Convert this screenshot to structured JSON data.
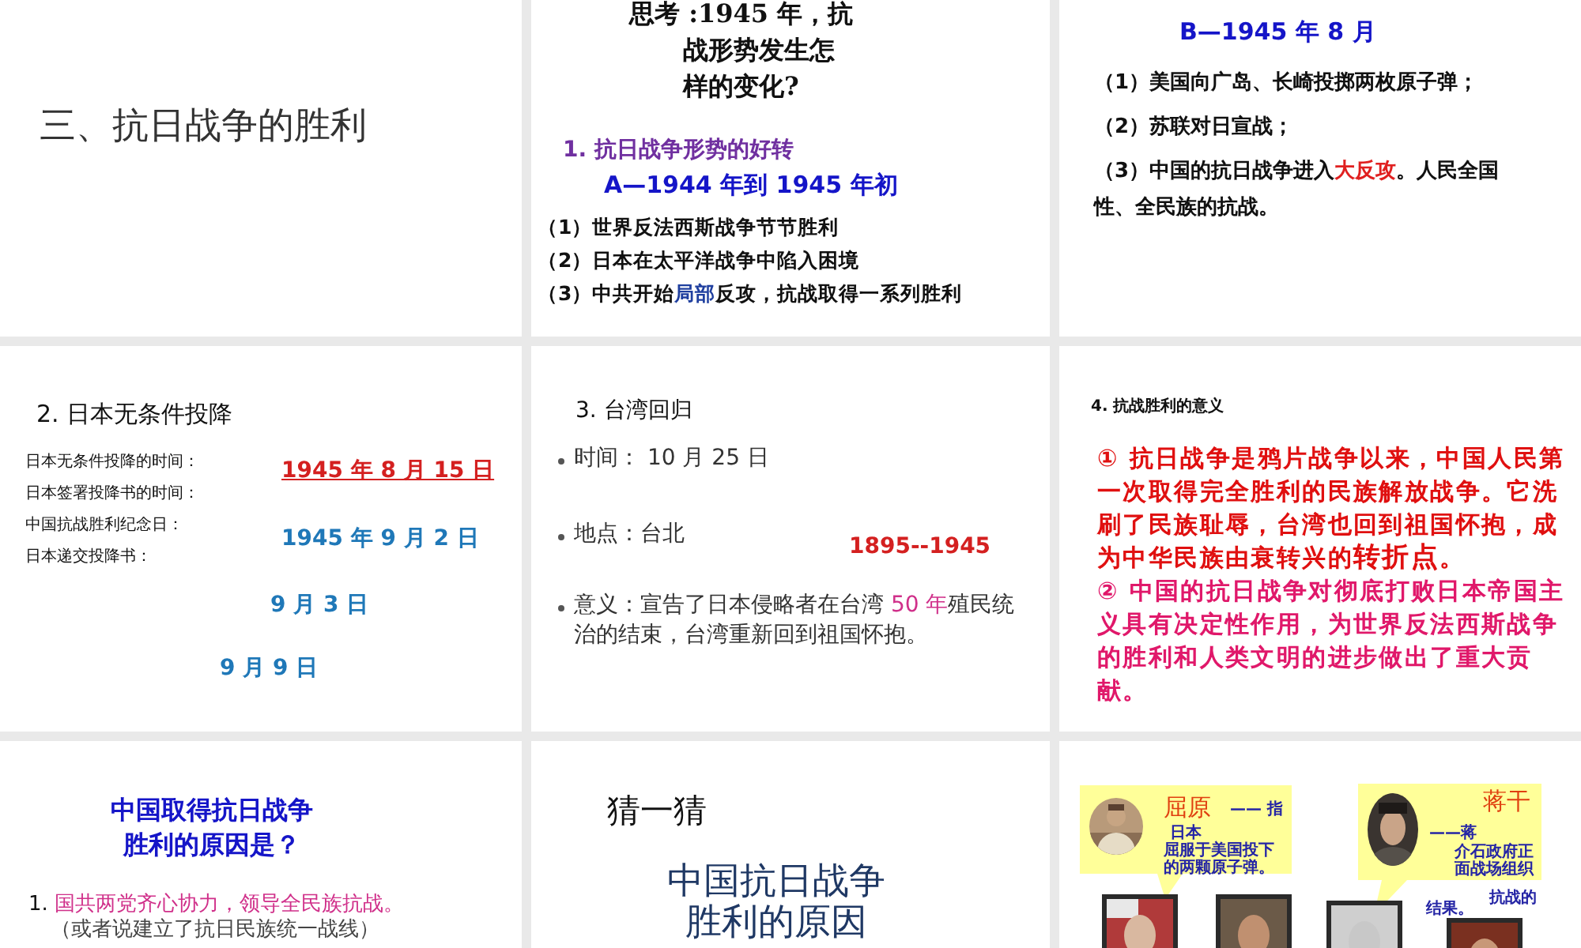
{
  "slides": [
    {
      "kind": "title",
      "title": "三、抗日战争的胜利"
    },
    {
      "kind": "outline",
      "question": [
        "思考 :1945 年，抗",
        "战形势发生怎",
        "样的变化?"
      ],
      "heading": "1. 抗日战争形势的好转",
      "subheading": "A—1944 年到 1945 年初",
      "items": [
        {
          "segments": [
            {
              "text": "（1）世界反法西斯战争节节胜利",
              "emphasis": false
            }
          ]
        },
        {
          "segments": [
            {
              "text": "（2）日本在太平洋战争中陷入困境",
              "emphasis": false
            }
          ]
        },
        {
          "segments": [
            {
              "text": "（3）中共开始",
              "emphasis": false
            },
            {
              "text": "局部",
              "emphasis": true
            },
            {
              "text": "反攻，抗战取得一系列胜利",
              "emphasis": false
            }
          ]
        }
      ]
    },
    {
      "kind": "events",
      "subheading": "B—1945 年 8 月",
      "items": [
        {
          "segments": [
            {
              "text": "（1）美国向广岛、长崎投掷两枚原子弹；",
              "emphasis": false
            }
          ]
        },
        {
          "segments": [
            {
              "text": "（2）苏联对日宣战；",
              "emphasis": false
            }
          ]
        },
        {
          "segments": [
            {
              "text": "（3）中国的抗日战争进入",
              "emphasis": false
            },
            {
              "text": "大反攻",
              "emphasis": true
            },
            {
              "text": "。人民全国性、全民族的抗战。",
              "emphasis": false
            }
          ]
        }
      ]
    },
    {
      "kind": "dates",
      "heading": "2. 日本无条件投降",
      "labels": [
        "日本无条件投降的时间：",
        "日本签署投降书的时间：",
        "中国抗战胜利纪念日：",
        "日本递交投降书："
      ],
      "dates": [
        {
          "text": "1945 年 8 月 15 日",
          "emphasis": true
        },
        {
          "text": "1945 年 9 月 2 日",
          "emphasis": false
        },
        {
          "text": "9 月 3 日",
          "emphasis": false
        },
        {
          "text": "9 月 9 日",
          "emphasis": false
        }
      ]
    },
    {
      "kind": "bullets",
      "heading": "3. 台湾回归",
      "items": [
        {
          "segments": [
            {
              "text": "时间： 10 月 25 日",
              "emphasis": false
            }
          ]
        },
        {
          "segments": [
            {
              "text": "地点：台北",
              "emphasis": false
            }
          ]
        },
        {
          "segments": [
            {
              "text": "意义：宣告了日本侵略者在台湾 ",
              "emphasis": false
            },
            {
              "text": "50 年",
              "emphasis": true
            },
            {
              "text": "殖民统治的结束，台湾重新回到祖国怀抱。",
              "emphasis": false
            }
          ]
        }
      ],
      "note": "1895--1945"
    },
    {
      "kind": "significance",
      "heading": "4. 抗战胜利的意义",
      "items": [
        {
          "segments": [
            {
              "text": "① 抗日战争是鸦片战争以来，中国人民第一次取得完全胜利的民族解放战争。它洗刷了民族耻辱，台湾也回到祖国怀抱，成为中华民族由衰转兴的",
              "emphasis": false
            },
            {
              "text": "转折点",
              "emphasis": true
            },
            {
              "text": "。",
              "emphasis": false
            }
          ]
        },
        {
          "segments": [
            {
              "text": "② 中国的抗日战争对彻底打败日本帝国主义具有决定性作用，为世界反法西斯战争的胜利和人类文明的进步做出了重大贡献。",
              "emphasis": false
            }
          ]
        }
      ]
    },
    {
      "kind": "question",
      "title": [
        "中国取得抗日战争",
        "胜利的原因是？"
      ],
      "items": [
        {
          "number": "1.",
          "segments": [
            {
              "text": "国共两党齐心协力，领导全民族抗战。",
              "emphasis": true
            }
          ],
          "aside": "（或者说建立了抗日民族统一战线）"
        }
      ]
    },
    {
      "kind": "guess",
      "title": "猜一猜",
      "subtitle": [
        "中国抗日战争",
        "胜利的原因"
      ]
    },
    {
      "kind": "callouts",
      "bubbles": [
        {
          "name": "屈原",
          "lines": [
            "—— 指",
            "日本",
            "屈服于美国投下",
            "的两颗原子弹。"
          ]
        },
        {
          "name": "蒋干",
          "lines": [
            "——蒋",
            "介石政府正",
            "面战场组织"
          ]
        }
      ],
      "trailing": [
        "抗战的",
        "结果。"
      ],
      "portraits": [
        {
          "kind": "picture"
        },
        {
          "kind": "picture"
        },
        {
          "kind": "picture"
        },
        {
          "kind": "picture"
        }
      ]
    }
  ]
}
